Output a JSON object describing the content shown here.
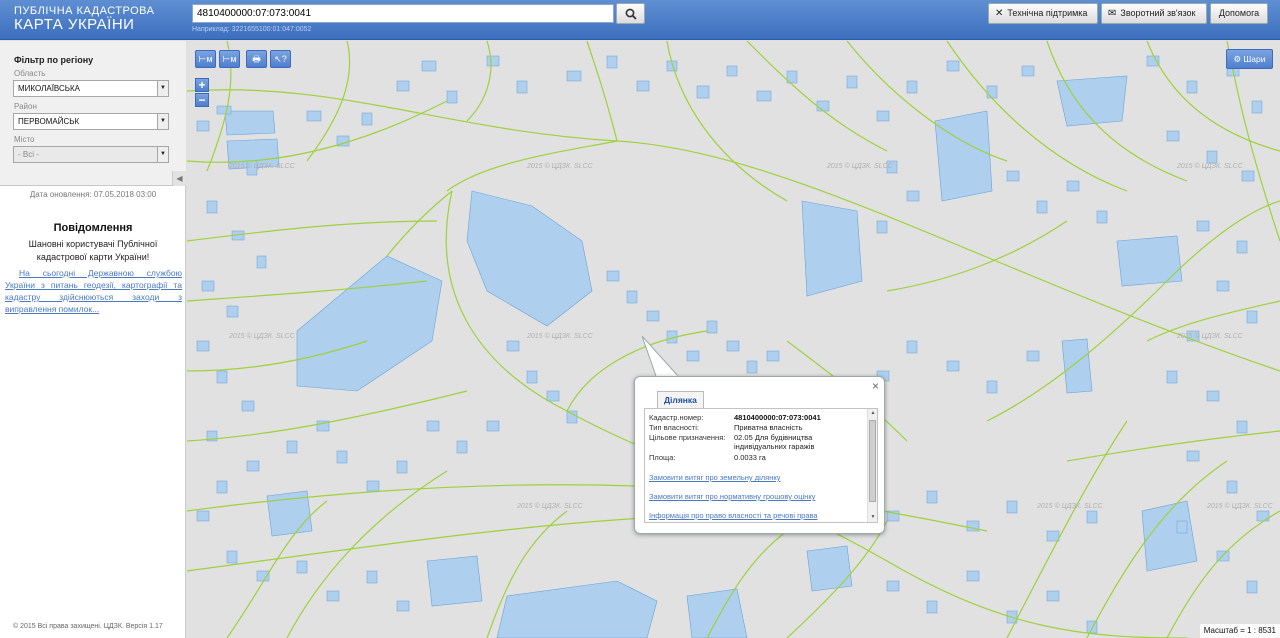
{
  "header": {
    "logo_line1": "ПУБЛІЧНА КАДАСТРОВА",
    "logo_line2": "КАРТА УКРАЇНИ",
    "search_value": "4810400000:07:073:0041",
    "search_hint": "Наприклад: 3221655100:01:047:0052",
    "support_label": "Технічна підтримка",
    "feedback_label": "Зворотний зв'язок",
    "help_label": "Допомога"
  },
  "sidebar": {
    "filter_title": "Фільтр по регіону",
    "region_label": "Область",
    "region_value": "МИКОЛАЇВСЬКА",
    "district_label": "Район",
    "district_value": "ПЕРВОМАЙСЬК",
    "city_label": "Місто",
    "city_value": "- Всі -",
    "update_date": "Дата оновлення: 07.05.2018 03:00",
    "news_title": "Повідомлення",
    "news_greeting": "Шановні користувачі Публічної кадастрової карти України!",
    "news_link": "На сьогодні Державною службою України з питань геодезії, картографії та кадастру здійснюються заходи з виправлення помилок...",
    "copyright": "© 2015 Всі права захищені. ЦДЗК. Версія 1.17"
  },
  "map": {
    "tools": {
      "ruler": "⊢м",
      "area": "⊢м",
      "print": "🖶",
      "info": "↖?"
    },
    "zoom_in": "+",
    "zoom_out": "−",
    "layers_label": "Шари",
    "watermark": "2015 © ЦДЗК. SLCC",
    "scale_label": "Масштаб = 1 : 8531"
  },
  "popup": {
    "tab_label": "Ділянка",
    "close": "×",
    "fields": [
      {
        "label": "Кадастр.номер:",
        "value": "4810400000:07:073:0041"
      },
      {
        "label": "Тип власності:",
        "value": "Приватна власність"
      },
      {
        "label": "Цільове призначення:",
        "value": "02.05 Для будівництва індивідуальних гаражів"
      },
      {
        "label": "Площа:",
        "value": "0.0033 га"
      }
    ],
    "links": [
      "Замовити витяг про земельну ділянку",
      "Замовити витяг про нормативну грошову оцінку",
      "Інформація про право власності та речові права"
    ]
  },
  "colors": {
    "header_top": "#5f8fd2",
    "header_bottom": "#3d6fbf",
    "parcel_line": "#9ed13b",
    "building_fill": "#aed0ee",
    "building_stroke": "#6aa2d8",
    "link": "#4a78c3"
  }
}
